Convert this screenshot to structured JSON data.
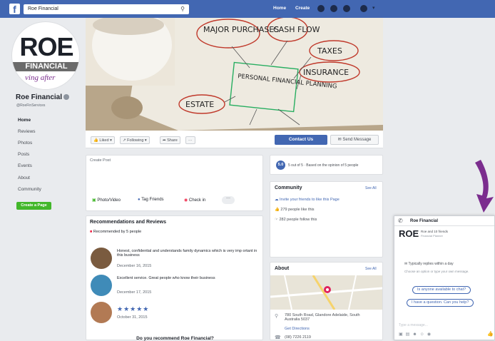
{
  "topbar": {
    "search_value": "Roe Financial",
    "home": "Home",
    "create": "Create",
    "fb_letter": "f"
  },
  "page": {
    "logo_main": "ROE",
    "logo_band": "FINANCIAL",
    "logo_tag": "ving after",
    "name": "Roe Financial",
    "handle": "@RoeFinServices",
    "nav": [
      "Home",
      "Reviews",
      "Photos",
      "Posts",
      "Events",
      "About",
      "Community"
    ],
    "create_page": "Create a Page"
  },
  "cover": {
    "words": [
      "MAJOR PURCHASES",
      "CASH FLOW",
      "TAXES",
      "INSURANCE",
      "PERSONAL FINANCIAL PLANNING",
      "ESTATE"
    ]
  },
  "actions": {
    "liked": "Liked",
    "following": "Following",
    "share": "Share",
    "more": "···",
    "contact": "Contact Us",
    "send": "Send Message"
  },
  "create_post": {
    "title": "Create Post",
    "photo": "Photo/Video",
    "tag": "Tag Friends",
    "checkin": "Check in",
    "more": "···"
  },
  "reviews": {
    "title": "Recommendations and Reviews",
    "summary": "Recommended by 5 people",
    "items": [
      {
        "text": "Honest, confidential and understands family dynamics which is very imp ortant in this business",
        "date": "December 16, 2015"
      },
      {
        "text": "Excellent service. Great people who know their business",
        "date": "December 17, 2015"
      },
      {
        "text": "★★★★★",
        "date": "October 31, 2015"
      }
    ],
    "question": "Do you recommend Roe Financial?"
  },
  "rating": {
    "score": "5.0",
    "text": "5 out of 5 · Based on the opinion of 5 people"
  },
  "community": {
    "title": "Community",
    "see_all": "See All",
    "invite": "Invite your friends to like this Page",
    "likes": "279 people like this",
    "follows": "282 people follow this"
  },
  "about": {
    "title": "About",
    "see_all": "See All",
    "address": "780 South Road, Glandore Adelaide, South Australia 5037",
    "directions": "Get Directions",
    "phone": "(08) 7226 2119"
  },
  "chat": {
    "title": "Roe Financial",
    "header_line": "Roe and 10 friends",
    "header_sub": "Financial Planner",
    "replies": "Typically replies within a day",
    "hint": "Choose an option or type your own message.",
    "q1": "Is anyone available to chat?",
    "q2": "I have a question. Can you help?",
    "placeholder": "Type a message..."
  },
  "colors": {
    "brand": "#4267b2",
    "green": "#42b72a",
    "arrow": "#7b2d8e"
  }
}
